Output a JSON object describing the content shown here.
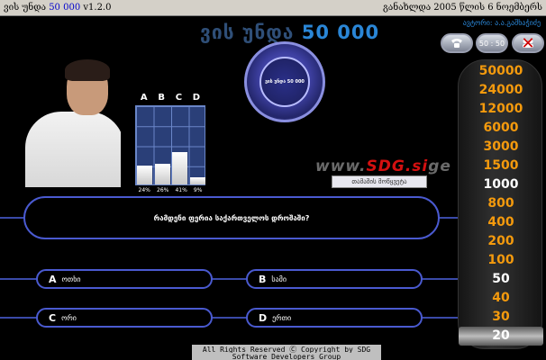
{
  "titlebar": {
    "left_prefix": "ვის უნდა",
    "left_amount": "50 000",
    "left_version": "v1.2.0",
    "right_text": "განახლდა 2005 წლის 6 ნოემბერს"
  },
  "game_title": {
    "text": "ვის უნდა",
    "amount": "50 000"
  },
  "author": "ავტორი: ა.ა.გაშხაჭიძე",
  "logo_text": "ვის უნდა 50 000",
  "lifelines": {
    "phone_icon": "phone-icon",
    "fifty_label": "50 : 50",
    "audience_icon": "audience-icon",
    "audience_used": true
  },
  "poll": {
    "letters": [
      "A",
      "B",
      "C",
      "D"
    ],
    "percents": [
      "24%",
      "26%",
      "41%",
      "9%"
    ],
    "values": [
      24,
      26,
      41,
      9
    ]
  },
  "watermark": {
    "prefix": "www.",
    "brand": "SDG",
    "suffix": ".si",
    "tail": "ge"
  },
  "name_plate": "თამაშის მოწყვეტა",
  "question": "რამდენი ფერია საქართველოს დროშაში?",
  "answers": [
    {
      "letter": "A",
      "text": "ოთხი"
    },
    {
      "letter": "B",
      "text": "სამი"
    },
    {
      "letter": "C",
      "text": "ორი"
    },
    {
      "letter": "D",
      "text": "ერთი"
    }
  ],
  "money_ladder": [
    "50000",
    "24000",
    "12000",
    "6000",
    "3000",
    "1500",
    "1000",
    "800",
    "400",
    "200",
    "100",
    "50",
    "40",
    "30",
    "20"
  ],
  "safe_levels": [
    "1000",
    "50"
  ],
  "current_level": "20",
  "footer": {
    "line1": "All Rights Reserved  Ⓒ Copyright by SDG",
    "line2": "Software Developers Group"
  },
  "colors": {
    "accent": "#2a86d6",
    "ladder": "#f49a0d",
    "border": "#4a5ad0"
  }
}
